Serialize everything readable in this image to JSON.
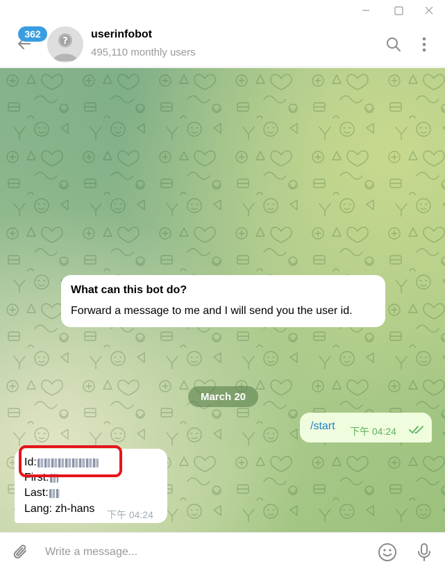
{
  "window": {
    "minimize_icon": "minimize-icon",
    "maximize_icon": "maximize-icon",
    "close_icon": "close-icon"
  },
  "header": {
    "unread_count": "362",
    "title": "userinfobot",
    "subtitle": "495,110 monthly users",
    "back_icon": "arrow-left-icon",
    "avatar_icon": "unknown-user-icon",
    "search_icon": "search-icon",
    "menu_icon": "more-vertical-icon",
    "accent_color": "#3a9de0"
  },
  "chat": {
    "background_pattern": "doodle-pattern",
    "bot_info": {
      "title": "What can this bot do?",
      "text": "Forward a message to me and I will send you the user id."
    },
    "date_separator": "March 20",
    "outgoing": {
      "text": "/start",
      "time": "下午 04:24",
      "status_icon": "double-check-icon"
    },
    "incoming": {
      "lines": [
        {
          "label": "Id:",
          "value_redacted": true
        },
        {
          "label": "First:",
          "value_redacted": true
        },
        {
          "label": "Last:",
          "value_redacted": true
        },
        {
          "label": "Lang: zh-hans"
        }
      ],
      "time": "下午 04:24"
    },
    "annotation_color": "#e6141b"
  },
  "composer": {
    "placeholder": "Write a message...",
    "value": "",
    "attach_icon": "paperclip-icon",
    "emoji_icon": "smiley-icon",
    "mic_icon": "microphone-icon"
  }
}
